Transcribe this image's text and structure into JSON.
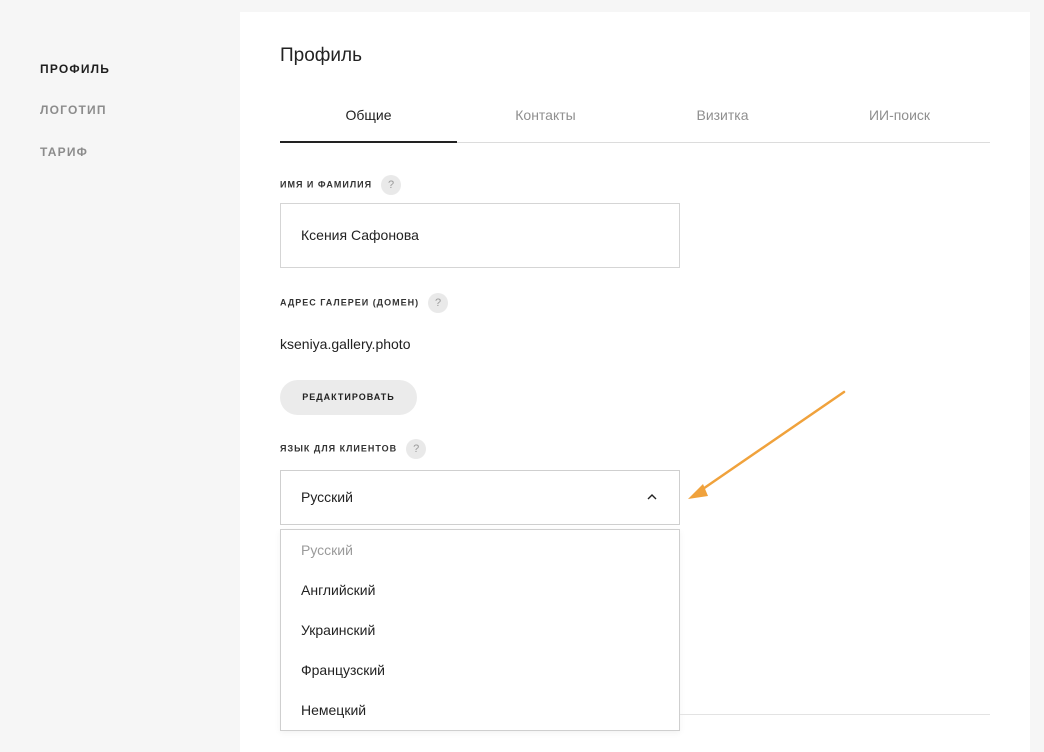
{
  "sidebar": {
    "items": [
      {
        "label": "ПРОФИЛЬ",
        "active": true
      },
      {
        "label": "ЛОГОТИП",
        "active": false
      },
      {
        "label": "ТАРИФ",
        "active": false
      }
    ]
  },
  "page": {
    "title": "Профиль"
  },
  "tabs": [
    {
      "label": "Общие",
      "active": true
    },
    {
      "label": "Контакты",
      "active": false
    },
    {
      "label": "Визитка",
      "active": false
    },
    {
      "label": "ИИ-поиск",
      "active": false
    }
  ],
  "fields": {
    "name": {
      "label": "ИМЯ И ФАМИЛИЯ",
      "help": "?",
      "value": "Ксения Сафонова"
    },
    "domain": {
      "label": "АДРЕС ГАЛЕРЕИ (ДОМЕН)",
      "help": "?",
      "value": "kseniya.gallery.photo",
      "edit_label": "РЕДАКТИРОВАТЬ"
    },
    "language": {
      "label": "ЯЗЫК ДЛЯ КЛИЕНТОВ",
      "help": "?",
      "value": "Русский",
      "options": [
        "Русский",
        "Английский",
        "Украинский",
        "Французский",
        "Немецкий"
      ]
    }
  },
  "colors": {
    "accent_arrow": "#f0a23c",
    "page_background": "#f6f6f6",
    "panel_background": "#ffffff",
    "muted_text": "#8f8f8f"
  },
  "icons": {
    "select_toggle": "chevron-up-icon",
    "annotation": "arrow-annotation-icon"
  }
}
